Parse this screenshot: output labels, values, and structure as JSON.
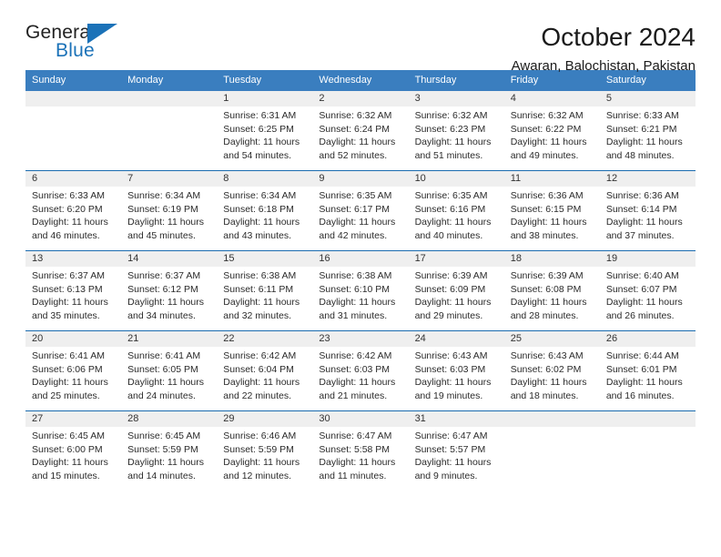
{
  "brand": {
    "name_top": "General",
    "name_bottom": "Blue",
    "triangle_icon": "triangle-icon",
    "accent_color": "#1b72b8"
  },
  "header": {
    "title": "October 2024",
    "subtitle": "Awaran, Balochistan, Pakistan"
  },
  "calendar": {
    "header_bg": "#3a7ebf",
    "row_divider": "#1b6cb0",
    "date_band_bg": "#efefef",
    "weekdays": [
      "Sunday",
      "Monday",
      "Tuesday",
      "Wednesday",
      "Thursday",
      "Friday",
      "Saturday"
    ],
    "weeks": [
      [
        {
          "day": "",
          "sunrise": "",
          "sunset": "",
          "daylight": ""
        },
        {
          "day": "",
          "sunrise": "",
          "sunset": "",
          "daylight": ""
        },
        {
          "day": "1",
          "sunrise": "Sunrise: 6:31 AM",
          "sunset": "Sunset: 6:25 PM",
          "daylight": "Daylight: 11 hours and 54 minutes."
        },
        {
          "day": "2",
          "sunrise": "Sunrise: 6:32 AM",
          "sunset": "Sunset: 6:24 PM",
          "daylight": "Daylight: 11 hours and 52 minutes."
        },
        {
          "day": "3",
          "sunrise": "Sunrise: 6:32 AM",
          "sunset": "Sunset: 6:23 PM",
          "daylight": "Daylight: 11 hours and 51 minutes."
        },
        {
          "day": "4",
          "sunrise": "Sunrise: 6:32 AM",
          "sunset": "Sunset: 6:22 PM",
          "daylight": "Daylight: 11 hours and 49 minutes."
        },
        {
          "day": "5",
          "sunrise": "Sunrise: 6:33 AM",
          "sunset": "Sunset: 6:21 PM",
          "daylight": "Daylight: 11 hours and 48 minutes."
        }
      ],
      [
        {
          "day": "6",
          "sunrise": "Sunrise: 6:33 AM",
          "sunset": "Sunset: 6:20 PM",
          "daylight": "Daylight: 11 hours and 46 minutes."
        },
        {
          "day": "7",
          "sunrise": "Sunrise: 6:34 AM",
          "sunset": "Sunset: 6:19 PM",
          "daylight": "Daylight: 11 hours and 45 minutes."
        },
        {
          "day": "8",
          "sunrise": "Sunrise: 6:34 AM",
          "sunset": "Sunset: 6:18 PM",
          "daylight": "Daylight: 11 hours and 43 minutes."
        },
        {
          "day": "9",
          "sunrise": "Sunrise: 6:35 AM",
          "sunset": "Sunset: 6:17 PM",
          "daylight": "Daylight: 11 hours and 42 minutes."
        },
        {
          "day": "10",
          "sunrise": "Sunrise: 6:35 AM",
          "sunset": "Sunset: 6:16 PM",
          "daylight": "Daylight: 11 hours and 40 minutes."
        },
        {
          "day": "11",
          "sunrise": "Sunrise: 6:36 AM",
          "sunset": "Sunset: 6:15 PM",
          "daylight": "Daylight: 11 hours and 38 minutes."
        },
        {
          "day": "12",
          "sunrise": "Sunrise: 6:36 AM",
          "sunset": "Sunset: 6:14 PM",
          "daylight": "Daylight: 11 hours and 37 minutes."
        }
      ],
      [
        {
          "day": "13",
          "sunrise": "Sunrise: 6:37 AM",
          "sunset": "Sunset: 6:13 PM",
          "daylight": "Daylight: 11 hours and 35 minutes."
        },
        {
          "day": "14",
          "sunrise": "Sunrise: 6:37 AM",
          "sunset": "Sunset: 6:12 PM",
          "daylight": "Daylight: 11 hours and 34 minutes."
        },
        {
          "day": "15",
          "sunrise": "Sunrise: 6:38 AM",
          "sunset": "Sunset: 6:11 PM",
          "daylight": "Daylight: 11 hours and 32 minutes."
        },
        {
          "day": "16",
          "sunrise": "Sunrise: 6:38 AM",
          "sunset": "Sunset: 6:10 PM",
          "daylight": "Daylight: 11 hours and 31 minutes."
        },
        {
          "day": "17",
          "sunrise": "Sunrise: 6:39 AM",
          "sunset": "Sunset: 6:09 PM",
          "daylight": "Daylight: 11 hours and 29 minutes."
        },
        {
          "day": "18",
          "sunrise": "Sunrise: 6:39 AM",
          "sunset": "Sunset: 6:08 PM",
          "daylight": "Daylight: 11 hours and 28 minutes."
        },
        {
          "day": "19",
          "sunrise": "Sunrise: 6:40 AM",
          "sunset": "Sunset: 6:07 PM",
          "daylight": "Daylight: 11 hours and 26 minutes."
        }
      ],
      [
        {
          "day": "20",
          "sunrise": "Sunrise: 6:41 AM",
          "sunset": "Sunset: 6:06 PM",
          "daylight": "Daylight: 11 hours and 25 minutes."
        },
        {
          "day": "21",
          "sunrise": "Sunrise: 6:41 AM",
          "sunset": "Sunset: 6:05 PM",
          "daylight": "Daylight: 11 hours and 24 minutes."
        },
        {
          "day": "22",
          "sunrise": "Sunrise: 6:42 AM",
          "sunset": "Sunset: 6:04 PM",
          "daylight": "Daylight: 11 hours and 22 minutes."
        },
        {
          "day": "23",
          "sunrise": "Sunrise: 6:42 AM",
          "sunset": "Sunset: 6:03 PM",
          "daylight": "Daylight: 11 hours and 21 minutes."
        },
        {
          "day": "24",
          "sunrise": "Sunrise: 6:43 AM",
          "sunset": "Sunset: 6:03 PM",
          "daylight": "Daylight: 11 hours and 19 minutes."
        },
        {
          "day": "25",
          "sunrise": "Sunrise: 6:43 AM",
          "sunset": "Sunset: 6:02 PM",
          "daylight": "Daylight: 11 hours and 18 minutes."
        },
        {
          "day": "26",
          "sunrise": "Sunrise: 6:44 AM",
          "sunset": "Sunset: 6:01 PM",
          "daylight": "Daylight: 11 hours and 16 minutes."
        }
      ],
      [
        {
          "day": "27",
          "sunrise": "Sunrise: 6:45 AM",
          "sunset": "Sunset: 6:00 PM",
          "daylight": "Daylight: 11 hours and 15 minutes."
        },
        {
          "day": "28",
          "sunrise": "Sunrise: 6:45 AM",
          "sunset": "Sunset: 5:59 PM",
          "daylight": "Daylight: 11 hours and 14 minutes."
        },
        {
          "day": "29",
          "sunrise": "Sunrise: 6:46 AM",
          "sunset": "Sunset: 5:59 PM",
          "daylight": "Daylight: 11 hours and 12 minutes."
        },
        {
          "day": "30",
          "sunrise": "Sunrise: 6:47 AM",
          "sunset": "Sunset: 5:58 PM",
          "daylight": "Daylight: 11 hours and 11 minutes."
        },
        {
          "day": "31",
          "sunrise": "Sunrise: 6:47 AM",
          "sunset": "Sunset: 5:57 PM",
          "daylight": "Daylight: 11 hours and 9 minutes."
        },
        {
          "day": "",
          "sunrise": "",
          "sunset": "",
          "daylight": ""
        },
        {
          "day": "",
          "sunrise": "",
          "sunset": "",
          "daylight": ""
        }
      ]
    ]
  }
}
